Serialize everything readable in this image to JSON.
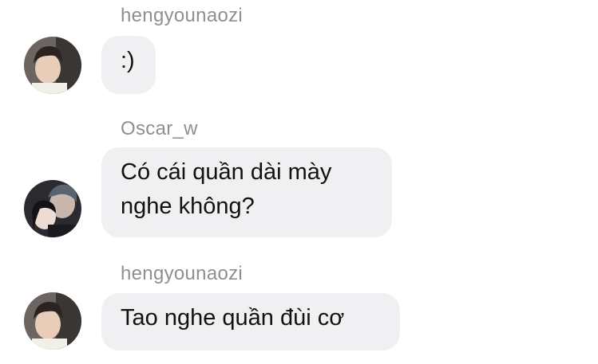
{
  "messages": [
    {
      "sender": "hengyounaozi",
      "text": ":)",
      "avatar": "avatar-hengyounaozi"
    },
    {
      "sender": "Oscar_w",
      "text_lines": [
        "Có cái quần dài mày",
        "nghe không?"
      ],
      "avatar": "avatar-oscar-w"
    },
    {
      "sender": "hengyounaozi",
      "text": "Tao nghe quần đùi cơ",
      "avatar": "avatar-hengyounaozi"
    }
  ],
  "colors": {
    "bubble_bg": "#f0f0f3",
    "sender_text": "#8e8e93",
    "message_text": "#111111"
  }
}
